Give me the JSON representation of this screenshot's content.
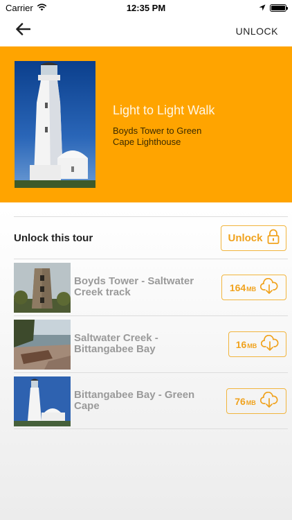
{
  "status": {
    "carrier": "Carrier",
    "time": "12:35 PM"
  },
  "nav": {
    "unlock_label": "UNLOCK"
  },
  "hero": {
    "title": "Light to Light Walk",
    "subtitle": "Boyds Tower to Green Cape Lighthouse"
  },
  "unlock_section": {
    "label": "Unlock this tour",
    "button_label": "Unlock"
  },
  "tours": [
    {
      "title": "Boyds Tower - Saltwater Creek track",
      "size": "164",
      "unit": "MB"
    },
    {
      "title": "Saltwater Creek - Bittangabee Bay",
      "size": "16",
      "unit": "MB"
    },
    {
      "title": "Bittangabee Bay - Green Cape",
      "size": "76",
      "unit": "MB"
    }
  ],
  "colors": {
    "accent": "#ffa400",
    "button_border": "#f1b43c",
    "button_text": "#f0a21d",
    "tour_title": "#9a9a9a"
  },
  "icons": [
    "wifi-icon",
    "location-arrow-icon",
    "battery-icon",
    "back-arrow-icon",
    "lock-icon",
    "cloud-download-icon"
  ]
}
